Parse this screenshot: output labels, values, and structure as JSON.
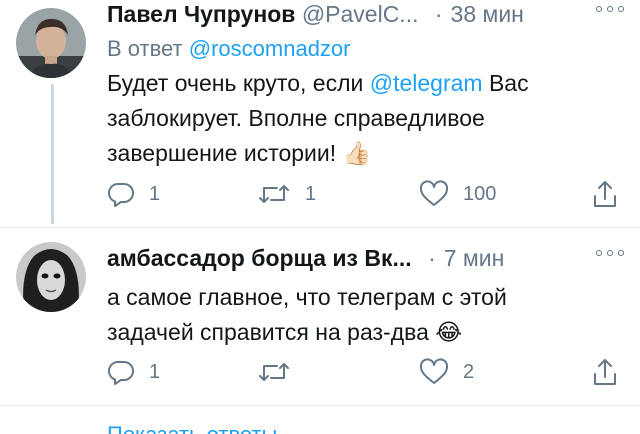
{
  "tweets": [
    {
      "name": "Павел Чупрунов",
      "handle": "@PavelC...",
      "separator": "·",
      "time": "38 мин",
      "reply_to_prefix": "В ответ",
      "reply_to_handle": "@roscomnadzor",
      "text_part1": "Будет очень круто, если ",
      "text_mention": "@telegram",
      "text_part2": " Вас заблокирует. Вполне справедливое завершение истории!",
      "emoji": "👍🏻",
      "reply_count": "1",
      "retweet_count": "1",
      "like_count": "100"
    },
    {
      "name": "амбассадор борща из Вк...",
      "separator": "·",
      "time": "7 мин",
      "text_part1": "а самое главное, что телеграм с этой задачей справится на раз-два ",
      "emoji": "😂",
      "reply_count": "1",
      "retweet_count": "",
      "like_count": "2"
    }
  ],
  "show_replies_label": "Показать ответы",
  "icons": {
    "reply": "reply-icon",
    "retweet": "retweet-icon",
    "like": "heart-icon",
    "share": "share-icon",
    "more": "more-options-icon"
  },
  "colors": {
    "text": "#14171a",
    "muted": "#657786",
    "link": "#1da1f2",
    "divider": "#e6ecf0"
  }
}
